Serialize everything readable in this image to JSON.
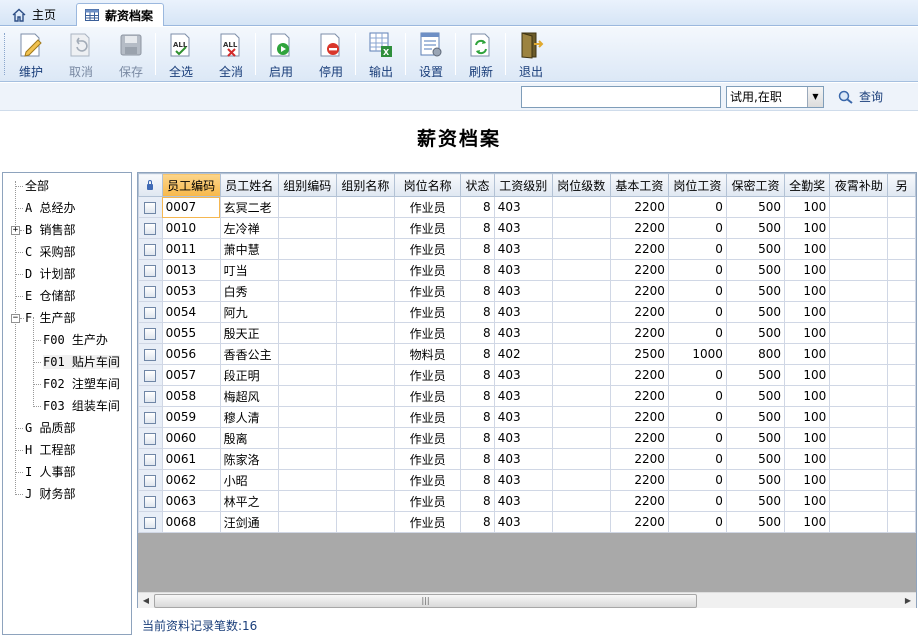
{
  "tabs": [
    {
      "label": "主页",
      "icon": "home-icon"
    },
    {
      "label": "薪资档案",
      "icon": "grid-icon"
    }
  ],
  "toolbar": {
    "buttons": [
      {
        "label": "维护",
        "icon": "edit-icon"
      },
      {
        "label": "取消",
        "icon": "undo-icon"
      },
      {
        "label": "保存",
        "icon": "save-icon"
      },
      {
        "label": "全选",
        "icon": "select-all-icon"
      },
      {
        "label": "全消",
        "icon": "deselect-all-icon"
      },
      {
        "label": "启用",
        "icon": "enable-icon"
      },
      {
        "label": "停用",
        "icon": "disable-icon"
      },
      {
        "label": "输出",
        "icon": "export-icon"
      },
      {
        "label": "设置",
        "icon": "settings-icon"
      },
      {
        "label": "刷新",
        "icon": "refresh-icon"
      },
      {
        "label": "退出",
        "icon": "exit-icon"
      }
    ]
  },
  "search": {
    "value": "",
    "status_value": "试用,在职",
    "query_label": "查询"
  },
  "page_title": "薪资档案",
  "tree": [
    {
      "label": "全部"
    },
    {
      "label": "A 总经办"
    },
    {
      "label": "B 销售部"
    },
    {
      "label": "C 采购部"
    },
    {
      "label": "D 计划部"
    },
    {
      "label": "E 仓储部"
    },
    {
      "label": "F 生产部"
    },
    {
      "label": "F00 生产办"
    },
    {
      "label": "F01 贴片车间"
    },
    {
      "label": "F02 注塑车间"
    },
    {
      "label": "F03 组装车间"
    },
    {
      "label": "G 品质部"
    },
    {
      "label": "H 工程部"
    },
    {
      "label": "I 人事部"
    },
    {
      "label": "J 财务部"
    }
  ],
  "table": {
    "columns": [
      "员工编码",
      "员工姓名",
      "组别编码",
      "组别名称",
      "岗位名称",
      "状态",
      "工资级别",
      "岗位级数",
      "基本工资",
      "岗位工资",
      "保密工资",
      "全勤奖",
      "夜霄补助",
      "另"
    ],
    "rows": [
      [
        "0007",
        "玄冥二老",
        "",
        "",
        "作业员",
        "8",
        "403",
        "",
        "2200",
        "0",
        "500",
        "100",
        "",
        ""
      ],
      [
        "0010",
        "左冷禅",
        "",
        "",
        "作业员",
        "8",
        "403",
        "",
        "2200",
        "0",
        "500",
        "100",
        "",
        ""
      ],
      [
        "0011",
        "萧中慧",
        "",
        "",
        "作业员",
        "8",
        "403",
        "",
        "2200",
        "0",
        "500",
        "100",
        "",
        ""
      ],
      [
        "0013",
        "叮当",
        "",
        "",
        "作业员",
        "8",
        "403",
        "",
        "2200",
        "0",
        "500",
        "100",
        "",
        ""
      ],
      [
        "0053",
        "白秀",
        "",
        "",
        "作业员",
        "8",
        "403",
        "",
        "2200",
        "0",
        "500",
        "100",
        "",
        ""
      ],
      [
        "0054",
        "阿九",
        "",
        "",
        "作业员",
        "8",
        "403",
        "",
        "2200",
        "0",
        "500",
        "100",
        "",
        ""
      ],
      [
        "0055",
        "殷天正",
        "",
        "",
        "作业员",
        "8",
        "403",
        "",
        "2200",
        "0",
        "500",
        "100",
        "",
        ""
      ],
      [
        "0056",
        "香香公主",
        "",
        "",
        "物料员",
        "8",
        "402",
        "",
        "2500",
        "1000",
        "800",
        "100",
        "",
        ""
      ],
      [
        "0057",
        "段正明",
        "",
        "",
        "作业员",
        "8",
        "403",
        "",
        "2200",
        "0",
        "500",
        "100",
        "",
        ""
      ],
      [
        "0058",
        "梅超风",
        "",
        "",
        "作业员",
        "8",
        "403",
        "",
        "2200",
        "0",
        "500",
        "100",
        "",
        ""
      ],
      [
        "0059",
        "穆人清",
        "",
        "",
        "作业员",
        "8",
        "403",
        "",
        "2200",
        "0",
        "500",
        "100",
        "",
        ""
      ],
      [
        "0060",
        "殷离",
        "",
        "",
        "作业员",
        "8",
        "403",
        "",
        "2200",
        "0",
        "500",
        "100",
        "",
        ""
      ],
      [
        "0061",
        "陈家洛",
        "",
        "",
        "作业员",
        "8",
        "403",
        "",
        "2200",
        "0",
        "500",
        "100",
        "",
        ""
      ],
      [
        "0062",
        "小昭",
        "",
        "",
        "作业员",
        "8",
        "403",
        "",
        "2200",
        "0",
        "500",
        "100",
        "",
        ""
      ],
      [
        "0063",
        "林平之",
        "",
        "",
        "作业员",
        "8",
        "403",
        "",
        "2200",
        "0",
        "500",
        "100",
        "",
        ""
      ],
      [
        "0068",
        "汪剑通",
        "",
        "",
        "作业员",
        "8",
        "403",
        "",
        "2200",
        "0",
        "500",
        "100",
        "",
        ""
      ]
    ]
  },
  "status_bar": {
    "record_count": "当前资料记录笔数:16"
  },
  "colors": {
    "sorted_header": "#f7b84b",
    "toolbar_text": "#1a3e7a",
    "border": "#8ea3bd"
  }
}
